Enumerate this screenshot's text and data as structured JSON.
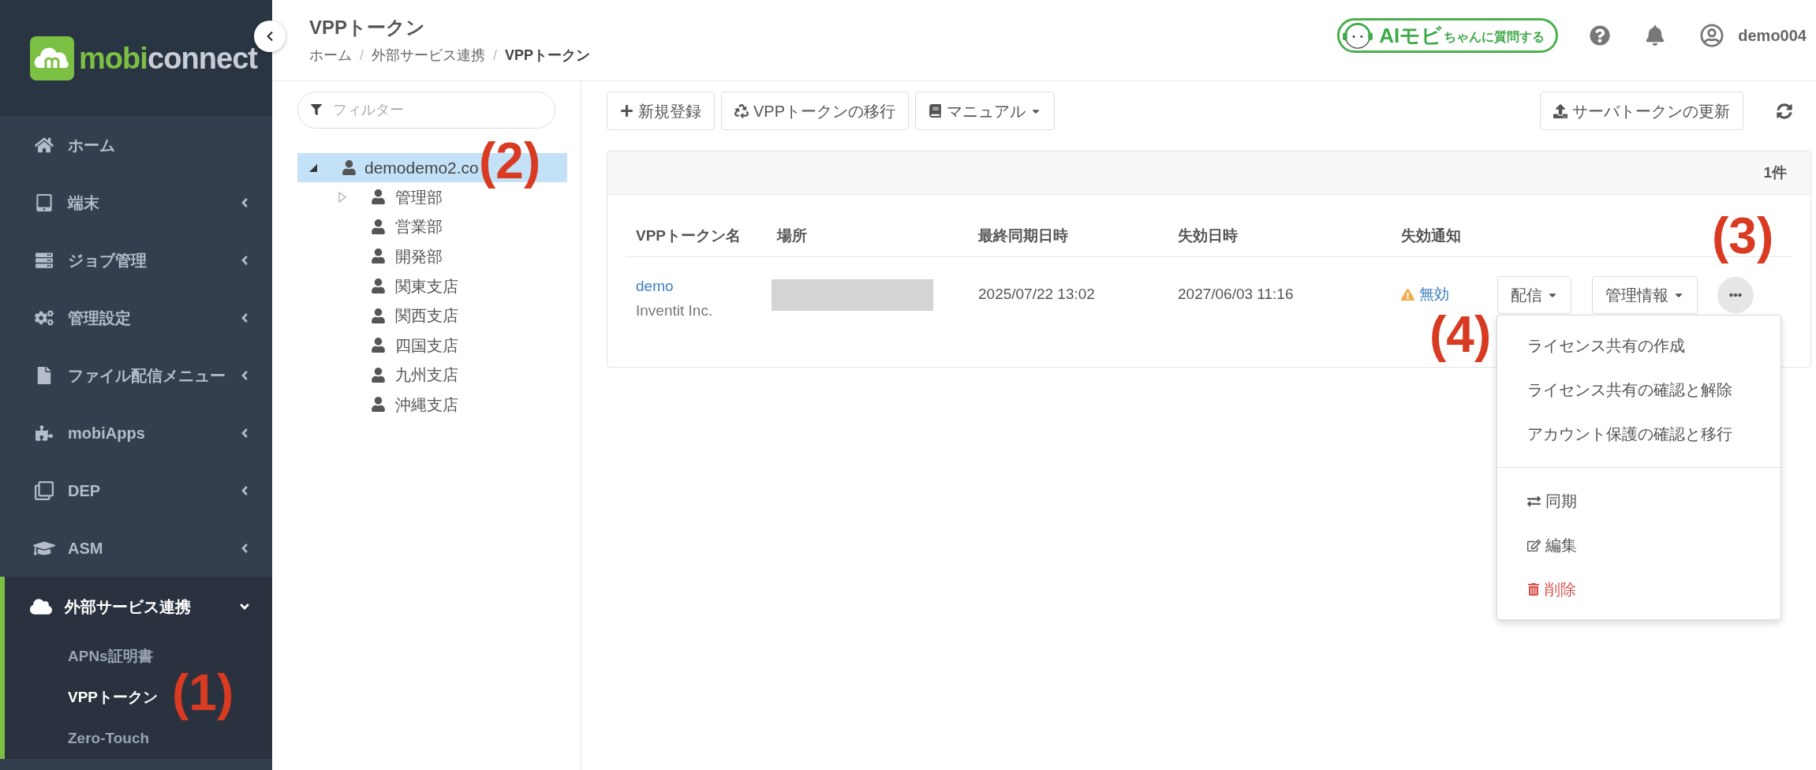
{
  "sidebar": {
    "logo": {
      "part_1": "mobi",
      "part_2": "connect"
    },
    "items": [
      {
        "label": "ホーム",
        "kind": "link",
        "selected": false
      },
      {
        "label": "端末",
        "kind": "group",
        "selected": false,
        "expanded": false
      },
      {
        "label": "ジョブ管理",
        "kind": "group",
        "selected": false,
        "expanded": false
      },
      {
        "label": "管理設定",
        "kind": "group",
        "selected": false,
        "expanded": false
      },
      {
        "label": "ファイル配信メニュー",
        "kind": "group",
        "selected": false,
        "expanded": false
      },
      {
        "label": "mobiApps",
        "kind": "group",
        "selected": false,
        "expanded": false
      },
      {
        "label": "DEP",
        "kind": "group",
        "selected": false,
        "expanded": false
      },
      {
        "label": "ASM",
        "kind": "group",
        "selected": false,
        "expanded": false
      },
      {
        "label": "外部サービス連携",
        "kind": "group",
        "selected": true,
        "expanded": true,
        "children": [
          {
            "label": "APNs証明書",
            "selected": false
          },
          {
            "label": "VPPトークン",
            "selected": true
          },
          {
            "label": "Zero-Touch",
            "selected": false
          }
        ]
      }
    ]
  },
  "header": {
    "title": "VPPトークン",
    "breadcrumbs": [
      {
        "label": "ホーム",
        "current": false,
        "separator": "/"
      },
      {
        "label": "外部サービス連携",
        "current": false,
        "separator": "/"
      },
      {
        "label": "VPPトークン",
        "current": true
      }
    ],
    "assistant_button": {
      "name": "AIモビ",
      "suffix": "ちゃんに質問する"
    },
    "user": "demo004"
  },
  "tree": {
    "filter": {
      "placeholder": "フィルター"
    },
    "root": {
      "label": "demodemo2.co",
      "selected": true,
      "expanded": true,
      "children": [
        {
          "label": "管理部",
          "expandable": true,
          "selected": false
        },
        {
          "label": "営業部",
          "expandable": false,
          "selected": false
        },
        {
          "label": "開発部",
          "expandable": false,
          "selected": false
        },
        {
          "label": "関東支店",
          "expandable": false,
          "selected": false
        },
        {
          "label": "関西支店",
          "expandable": false,
          "selected": false
        },
        {
          "label": "四国支店",
          "expandable": false,
          "selected": false
        },
        {
          "label": "九州支店",
          "expandable": false,
          "selected": false
        },
        {
          "label": "沖縄支店",
          "expandable": false,
          "selected": false
        }
      ]
    }
  },
  "toolbar": {
    "buttons": [
      {
        "label": "新規登録",
        "dropdown": false
      },
      {
        "label": "VPPトークンの移行",
        "dropdown": false
      },
      {
        "label": "マニュアル",
        "dropdown": true
      }
    ],
    "right_button": {
      "label": "サーバトークンの更新"
    }
  },
  "table": {
    "count": "1件",
    "columns": [
      "VPPトークン名",
      "場所",
      "最終同期日時",
      "失効日時",
      "失効通知"
    ],
    "rows": [
      {
        "name": "demo",
        "organization": "Inventit Inc.",
        "last_sync": "2025/07/22 13:02",
        "expires": "2027/06/03 11:16",
        "notice": {
          "label": "無効",
          "warning": true
        },
        "actions": [
          {
            "label": "配信"
          },
          {
            "label": "管理情報"
          }
        ],
        "menu_open": true
      }
    ]
  },
  "menu": {
    "items": [
      {
        "label": "ライセンス共有の作成",
        "kind": "plain"
      },
      {
        "label": "ライセンス共有の確認と解除",
        "kind": "plain"
      },
      {
        "label": "アカウント保護の確認と移行",
        "kind": "plain"
      },
      {
        "kind": "divider"
      },
      {
        "label": "同期",
        "kind": "sync"
      },
      {
        "label": "編集",
        "kind": "edit"
      },
      {
        "label": "削除",
        "kind": "delete"
      }
    ]
  },
  "annotations": [
    "(1)",
    "(2)",
    "(3)",
    "(4)"
  ]
}
